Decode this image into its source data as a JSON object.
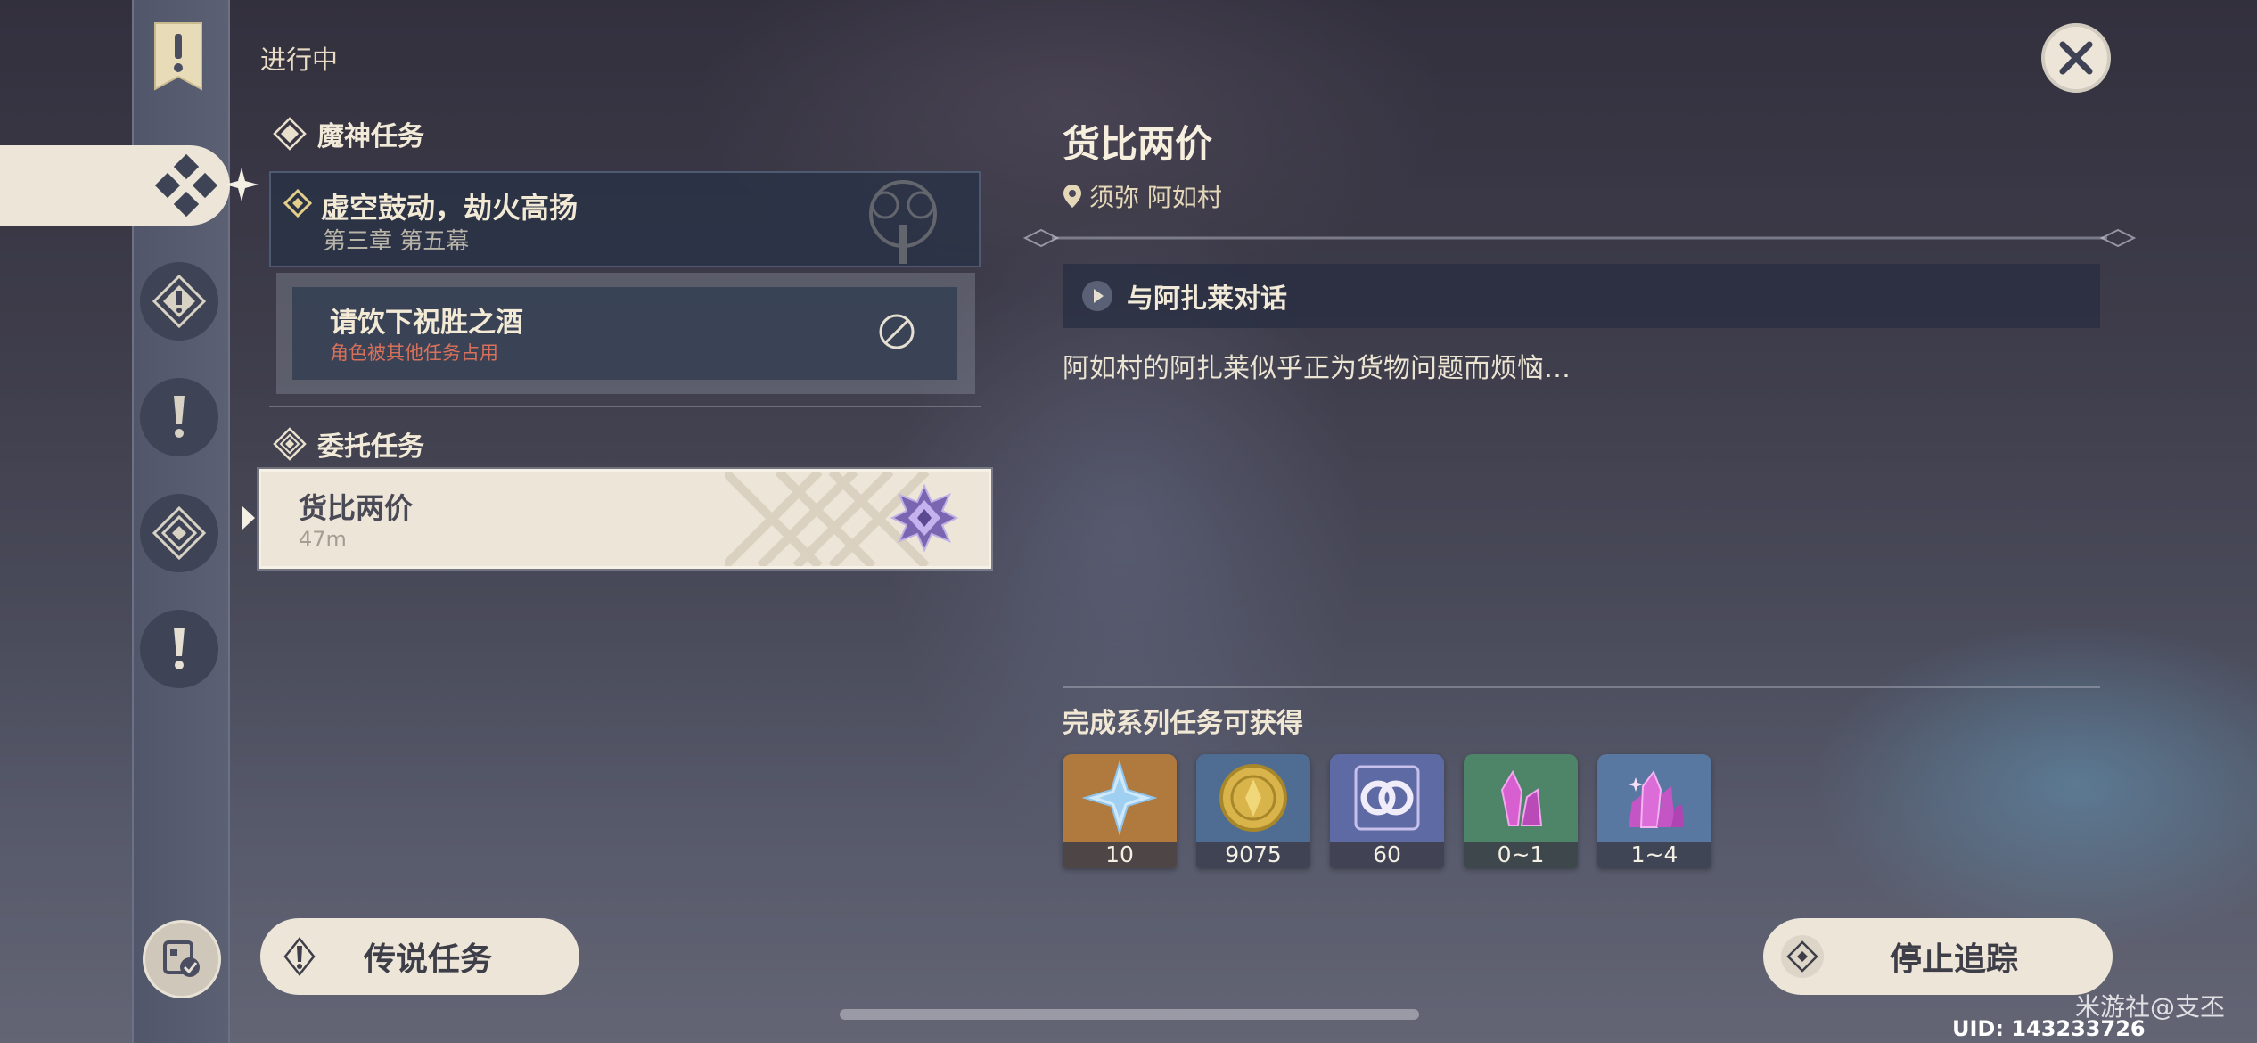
{
  "header": {
    "status_label": "进行中"
  },
  "archon": {
    "group_label": "魔神任务",
    "quest_title": "虚空鼓动，劫火高扬",
    "quest_chapter": "第三章 第五幕",
    "subquest_title": "请饮下祝胜之酒",
    "subquest_warning": "角色被其他任务占用"
  },
  "commission": {
    "group_label": "委托任务",
    "quest_title": "货比两价",
    "distance": "47m"
  },
  "detail": {
    "title": "货比两价",
    "location": "须弥 阿如村",
    "objective": "与阿扎莱对话",
    "description": "阿如村的阿扎莱似乎正为货物问题而烦恼…",
    "rewards_title": "完成系列任务可获得",
    "rewards": [
      {
        "icon": "primogem-icon",
        "count": "10",
        "bg": "#b07a3e"
      },
      {
        "icon": "mora-icon",
        "count": "9075",
        "bg": "#4f6c92"
      },
      {
        "icon": "companionship-exp-icon",
        "count": "60",
        "bg": "#5e6aa4"
      },
      {
        "icon": "crystal-ore-icon",
        "count": "0~1",
        "bg": "#4e8468"
      },
      {
        "icon": "crystal-cluster-icon",
        "count": "1~4",
        "bg": "#5878a2"
      }
    ]
  },
  "buttons": {
    "legend_quest": "传说任务",
    "stop_tracking": "停止追踪"
  },
  "footer": {
    "watermark": "米游社@支丕",
    "uid": "UID: 143233726"
  },
  "colors": {
    "panel_cream": "#ece5d8",
    "warning_red": "#d9705a",
    "gold": "#e4d8b8"
  }
}
